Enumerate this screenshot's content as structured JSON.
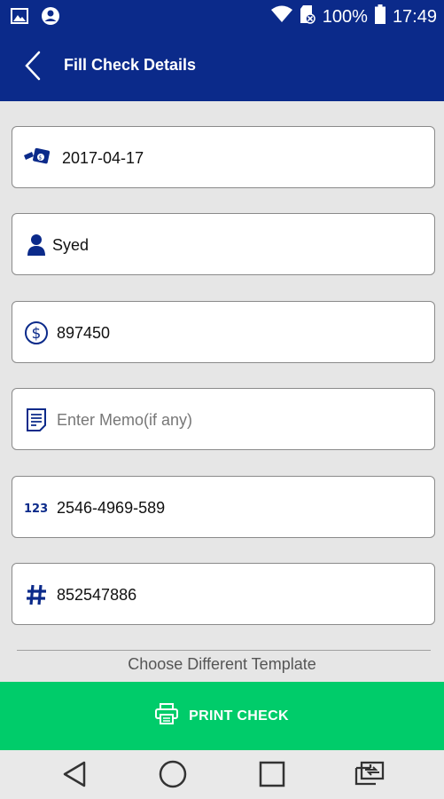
{
  "status_bar": {
    "battery": "100%",
    "time": "17:49"
  },
  "header": {
    "title": "Fill Check Details"
  },
  "form": {
    "date": "2017-04-17",
    "payee": "Syed",
    "amount": "897450",
    "memo_placeholder": "Enter Memo(if any)",
    "account_number": "2546-4969-589",
    "check_number": "852547886"
  },
  "footer": {
    "template_link": "Choose Different Template",
    "print_label": "PRINT CHECK"
  },
  "icons": {
    "date": "check-date-icon",
    "payee": "person-icon",
    "amount": "dollar-circle-icon",
    "memo": "memo-document-icon",
    "account": "numbers-123-icon",
    "check_number": "hash-icon"
  },
  "colors": {
    "primary": "#0b2a8a",
    "accent": "#00cc6a",
    "background": "#e6e6e6"
  }
}
